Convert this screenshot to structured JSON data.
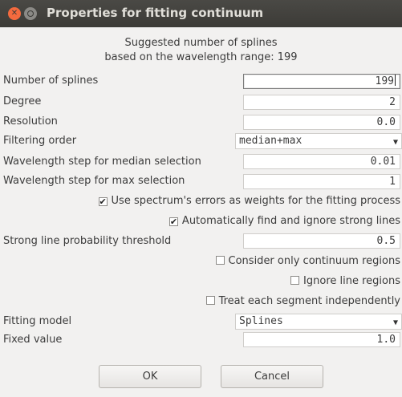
{
  "window": {
    "title": "Properties for fitting continuum"
  },
  "info": {
    "line1": "Suggested number of splines",
    "line2": "based on the wavelength range: 199"
  },
  "fields": {
    "num_splines": {
      "label": "Number of splines",
      "value": "199"
    },
    "degree": {
      "label": "Degree",
      "value": "2"
    },
    "resolution": {
      "label": "Resolution",
      "value": "0.0"
    },
    "filtering_order": {
      "label": "Filtering order",
      "value": "median+max"
    },
    "median_step": {
      "label": "Wavelength step for median selection",
      "value": "0.01"
    },
    "max_step": {
      "label": "Wavelength step for max selection",
      "value": "1"
    },
    "threshold": {
      "label": "Strong line probability threshold",
      "value": "0.5"
    },
    "fitting_model": {
      "label": "Fitting model",
      "value": "Splines"
    },
    "fixed_value": {
      "label": "Fixed value",
      "value": "1.0"
    }
  },
  "checks": {
    "use_errors": {
      "label": "Use spectrum's errors as weights for the fitting process",
      "checked": true,
      "mark": "✔"
    },
    "auto_ignore": {
      "label": "Automatically find and ignore strong lines",
      "checked": true,
      "mark": "✔"
    },
    "continuum_only": {
      "label": "Consider only continuum regions",
      "checked": false,
      "mark": ""
    },
    "ignore_lines": {
      "label": "Ignore line regions",
      "checked": false,
      "mark": ""
    },
    "independent": {
      "label": "Treat each segment independently",
      "checked": false,
      "mark": ""
    }
  },
  "buttons": {
    "ok": "OK",
    "cancel": "Cancel"
  },
  "icons": {
    "close": "close-icon",
    "minimize": "minimize-icon",
    "dropdown": "chevron-down-icon"
  },
  "colors": {
    "titlebar": "#3c3b37",
    "close": "#f46a3e",
    "background": "#f2f1f0"
  }
}
